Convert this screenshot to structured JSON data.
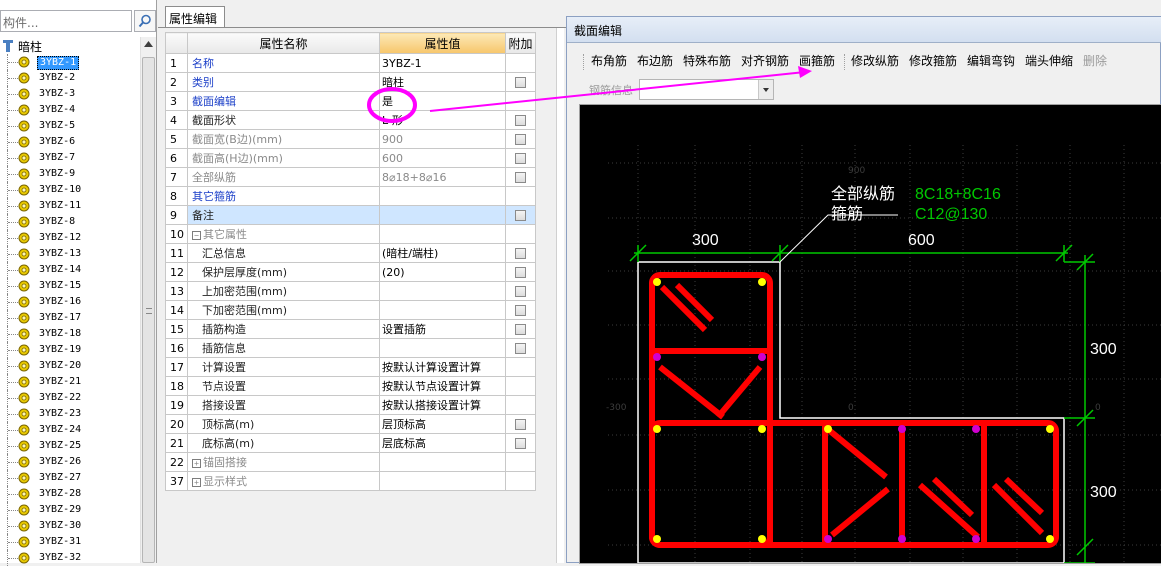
{
  "tree": {
    "search_placeholder": "构件...",
    "root_label": "暗柱",
    "items": [
      "3YBZ-1",
      "3YBZ-2",
      "3YBZ-3",
      "3YBZ-4",
      "3YBZ-5",
      "3YBZ-6",
      "3YBZ-7",
      "3YBZ-9",
      "3YBZ-10",
      "3YBZ-11",
      "3YBZ-8",
      "3YBZ-12",
      "3YBZ-13",
      "3YBZ-14",
      "3YBZ-15",
      "3YBZ-16",
      "3YBZ-17",
      "3YBZ-18",
      "3YBZ-19",
      "3YBZ-20",
      "3YBZ-21",
      "3YBZ-22",
      "3YBZ-23",
      "3YBZ-24",
      "3YBZ-25",
      "3YBZ-26",
      "3YBZ-27",
      "3YBZ-28",
      "3YBZ-29",
      "3YBZ-30",
      "3YBZ-31",
      "3YBZ-32"
    ],
    "selected_index": 0
  },
  "props": {
    "tab_label": "属性编辑",
    "headers": {
      "name": "属性名称",
      "value": "属性值",
      "extra": "附加"
    },
    "rows": [
      {
        "num": "1",
        "name": "名称",
        "value": "3YBZ-1",
        "style": "blue",
        "check": false
      },
      {
        "num": "2",
        "name": "类别",
        "value": "暗柱",
        "style": "blue",
        "check": true
      },
      {
        "num": "3",
        "name": "截面编辑",
        "value": "是",
        "style": "blue",
        "check": false
      },
      {
        "num": "4",
        "name": "截面形状",
        "value": "L-形",
        "style": "dark",
        "check": true
      },
      {
        "num": "5",
        "name": "截面宽(B边)(mm)",
        "value": "900",
        "style": "gray",
        "check": true
      },
      {
        "num": "6",
        "name": "截面高(H边)(mm)",
        "value": "600",
        "style": "gray",
        "check": true
      },
      {
        "num": "7",
        "name": "全部纵筋",
        "value": "8⌀18+8⌀16",
        "style": "gray",
        "check": true
      },
      {
        "num": "8",
        "name": "其它箍筋",
        "value": "",
        "style": "blue",
        "check": false
      },
      {
        "num": "9",
        "name": "备注",
        "value": "",
        "style": "dark",
        "check": true,
        "selected": true
      },
      {
        "num": "10",
        "name": "其它属性",
        "value": "",
        "style": "gray",
        "check": false,
        "group": "−"
      },
      {
        "num": "11",
        "name": "汇总信息",
        "value": "(暗柱/端柱)",
        "style": "dark",
        "check": true,
        "indent": true
      },
      {
        "num": "12",
        "name": "保护层厚度(mm)",
        "value": "(20)",
        "style": "dark",
        "check": true,
        "indent": true
      },
      {
        "num": "13",
        "name": "上加密范围(mm)",
        "value": "",
        "style": "dark",
        "check": true,
        "indent": true
      },
      {
        "num": "14",
        "name": "下加密范围(mm)",
        "value": "",
        "style": "dark",
        "check": true,
        "indent": true
      },
      {
        "num": "15",
        "name": "插筋构造",
        "value": "设置插筋",
        "style": "dark",
        "check": true,
        "indent": true
      },
      {
        "num": "16",
        "name": "插筋信息",
        "value": "",
        "style": "dark",
        "check": true,
        "indent": true
      },
      {
        "num": "17",
        "name": "计算设置",
        "value": "按默认计算设置计算",
        "style": "dark",
        "check": false,
        "indent": true
      },
      {
        "num": "18",
        "name": "节点设置",
        "value": "按默认节点设置计算",
        "style": "dark",
        "check": false,
        "indent": true
      },
      {
        "num": "19",
        "name": "搭接设置",
        "value": "按默认搭接设置计算",
        "style": "dark",
        "check": false,
        "indent": true
      },
      {
        "num": "20",
        "name": "顶标高(m)",
        "value": "层顶标高",
        "style": "dark",
        "check": true,
        "indent": true
      },
      {
        "num": "21",
        "name": "底标高(m)",
        "value": "层底标高",
        "style": "dark",
        "check": true,
        "indent": true
      },
      {
        "num": "22",
        "name": "锚固搭接",
        "value": "",
        "style": "gray",
        "check": false,
        "group": "+"
      },
      {
        "num": "37",
        "name": "显示样式",
        "value": "",
        "style": "gray",
        "check": false,
        "group": "+"
      }
    ]
  },
  "section": {
    "title": "截面编辑",
    "toolbar": [
      "布角筋",
      "布边筋",
      "特殊布筋",
      "对齐钢筋",
      "画箍筋",
      "修改纵筋",
      "修改箍筋",
      "编辑弯钩",
      "端头伸缩",
      "删除"
    ],
    "rebar_info_label": "钢筋信息",
    "drawing": {
      "label_all_long": "全部纵筋",
      "label_stirrup": "箍筋",
      "value_all_long": "8C18+8C16",
      "value_stirrup": "C12@130",
      "dim_left": "300",
      "dim_right": "600",
      "dim_v_top": "300",
      "dim_v_bottom": "300",
      "grid_top": "900",
      "grid_left": "-300",
      "grid_mid": "0",
      "grid_right": "0"
    }
  }
}
